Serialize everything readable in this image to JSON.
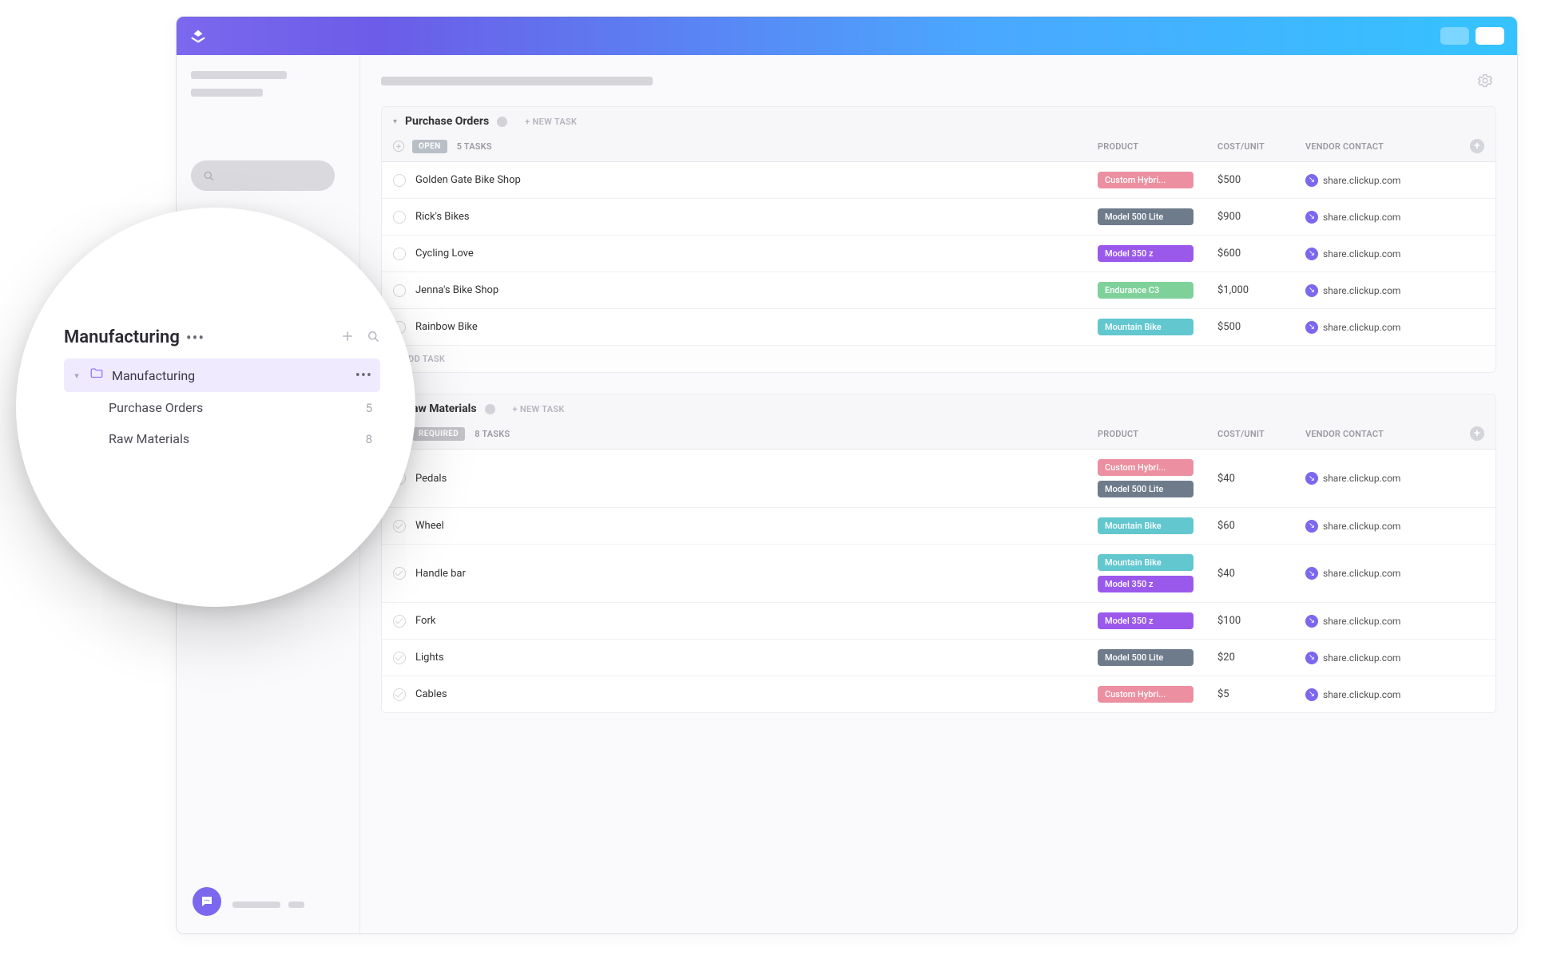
{
  "sidebar_overlay": {
    "title": "Manufacturing",
    "folder_item": "Manufacturing",
    "lists": [
      {
        "name": "Purchase Orders",
        "count": "5"
      },
      {
        "name": "Raw Materials",
        "count": "8"
      }
    ]
  },
  "columns": {
    "product": "PRODUCT",
    "cost": "COST/UNIT",
    "vendor": "VENDOR CONTACT"
  },
  "labels": {
    "new_task": "+ NEW TASK",
    "add_task": "+ ADD TASK"
  },
  "groups": [
    {
      "id": "po",
      "title": "Purchase Orders",
      "status_label": "OPEN",
      "status_class": "status-open",
      "task_count": "5 TASKS",
      "rows": [
        {
          "name": "Golden Gate Bike Shop",
          "products": [
            {
              "label": "Custom Hybri...",
              "cls": "tag-pink"
            }
          ],
          "cost": "$500",
          "vendor": "share.clickup.com"
        },
        {
          "name": "Rick's Bikes",
          "products": [
            {
              "label": "Model 500 Lite",
              "cls": "tag-slate"
            }
          ],
          "cost": "$900",
          "vendor": "share.clickup.com"
        },
        {
          "name": "Cycling Love",
          "products": [
            {
              "label": "Model 350 z",
              "cls": "tag-purple"
            }
          ],
          "cost": "$600",
          "vendor": "share.clickup.com"
        },
        {
          "name": "Jenna's Bike Shop",
          "products": [
            {
              "label": "Endurance C3",
              "cls": "tag-green"
            }
          ],
          "cost": "$1,000",
          "vendor": "share.clickup.com"
        },
        {
          "name": "Rainbow Bike",
          "products": [
            {
              "label": "Mountain Bike",
              "cls": "tag-teal"
            }
          ],
          "cost": "$500",
          "vendor": "share.clickup.com"
        }
      ]
    },
    {
      "id": "raw",
      "title": "Raw Materials",
      "status_label": "REQUIRED",
      "status_class": "status-required",
      "task_count": "8 TASKS",
      "rows": [
        {
          "name": "Pedals",
          "products": [
            {
              "label": "Custom Hybri...",
              "cls": "tag-pink"
            },
            {
              "label": "Model 500 Lite",
              "cls": "tag-slate"
            }
          ],
          "cost": "$40",
          "vendor": "share.clickup.com"
        },
        {
          "name": "Wheel",
          "products": [
            {
              "label": "Mountain Bike",
              "cls": "tag-teal"
            }
          ],
          "cost": "$60",
          "vendor": "share.clickup.com"
        },
        {
          "name": "Handle bar",
          "products": [
            {
              "label": "Mountain Bike",
              "cls": "tag-teal"
            },
            {
              "label": "Model 350 z",
              "cls": "tag-purple"
            }
          ],
          "cost": "$40",
          "vendor": "share.clickup.com"
        },
        {
          "name": "Fork",
          "products": [
            {
              "label": "Model 350 z",
              "cls": "tag-purple"
            }
          ],
          "cost": "$100",
          "vendor": "share.clickup.com"
        },
        {
          "name": "Lights",
          "products": [
            {
              "label": "Model 500 Lite",
              "cls": "tag-slate"
            }
          ],
          "cost": "$20",
          "vendor": "share.clickup.com"
        },
        {
          "name": "Cables",
          "products": [
            {
              "label": "Custom Hybri...",
              "cls": "tag-pink"
            }
          ],
          "cost": "$5",
          "vendor": "share.clickup.com"
        }
      ]
    }
  ]
}
